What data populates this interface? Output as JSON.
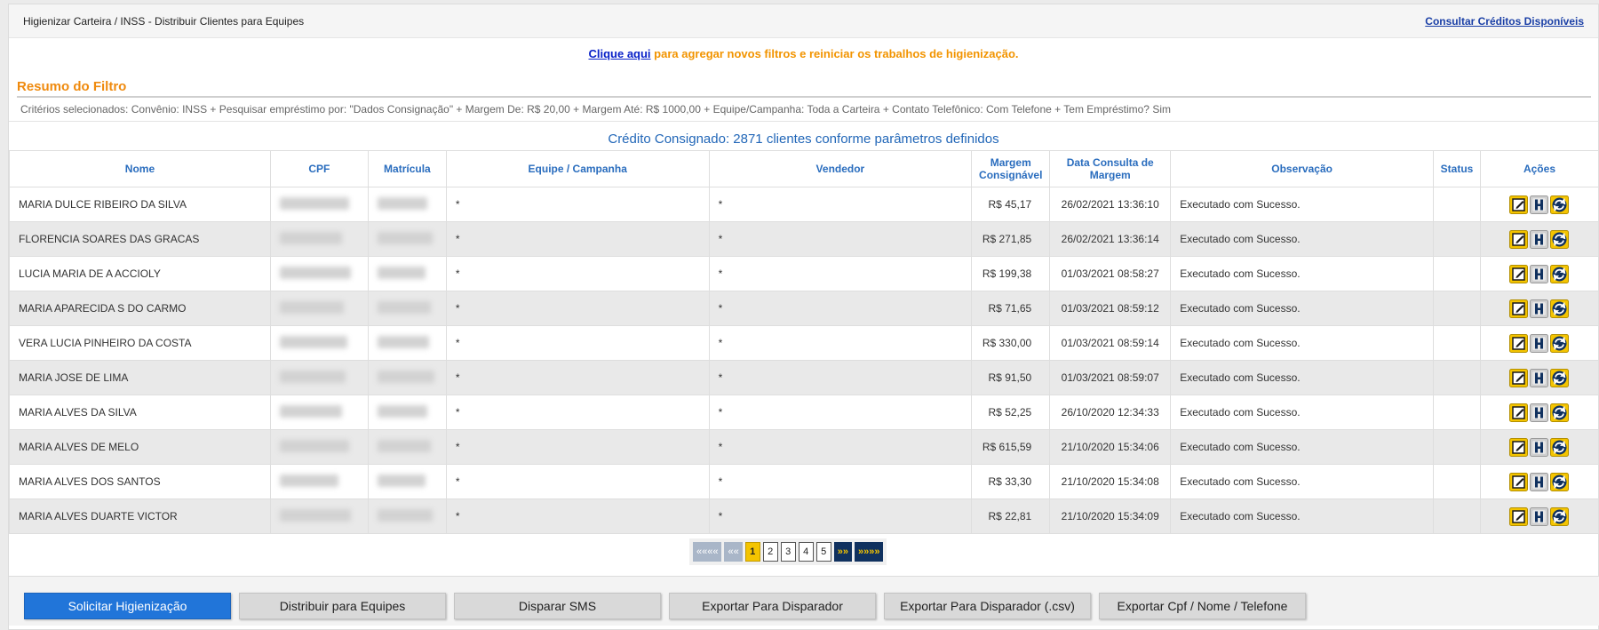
{
  "header": {
    "breadcrumb": "Higienizar Carteira / INSS - Distribuir Clientes para Equipes",
    "credits_link": "Consultar Créditos Disponíveis"
  },
  "reset": {
    "link": "Clique aqui",
    "text": " para agregar novos filtros e reiniciar os trabalhos de higienização."
  },
  "summary": {
    "title": "Resumo do Filtro",
    "criteria": "Critérios selecionados: Convênio: INSS + Pesquisar empréstimo por: \"Dados Consignação\" + Margem De: R$ 20,00 + Margem Até: R$ 1000,00 + Equipe/Campanha: Toda a Carteira + Contato Telefônico: Com Telefone + Tem Empréstimo? Sim"
  },
  "result_count": "Crédito Consignado: 2871 clientes conforme parâmetros definidos",
  "table": {
    "headers": {
      "nome": "Nome",
      "cpf": "CPF",
      "matricula": "Matrícula",
      "equipe": "Equipe / Campanha",
      "vendedor": "Vendedor",
      "margem": "Margem Consignável",
      "data": "Data Consulta de Margem",
      "obs": "Observação",
      "status": "Status",
      "acoes": "Ações"
    },
    "rows": [
      {
        "nome": "MARIA DULCE RIBEIRO DA SILVA",
        "equipe": "*",
        "vendedor": "*",
        "margem": "R$ 45,17",
        "data": "26/02/2021 13:36:10",
        "obs": "Executado com Sucesso.",
        "status": ""
      },
      {
        "nome": "FLORENCIA SOARES DAS GRACAS",
        "equipe": "*",
        "vendedor": "*",
        "margem": "R$ 271,85",
        "data": "26/02/2021 13:36:14",
        "obs": "Executado com Sucesso.",
        "status": ""
      },
      {
        "nome": "LUCIA MARIA DE A ACCIOLY",
        "equipe": "*",
        "vendedor": "*",
        "margem": "R$ 199,38",
        "data": "01/03/2021 08:58:27",
        "obs": "Executado com Sucesso.",
        "status": ""
      },
      {
        "nome": "MARIA APARECIDA S DO CARMO",
        "equipe": "*",
        "vendedor": "*",
        "margem": "R$ 71,65",
        "data": "01/03/2021 08:59:12",
        "obs": "Executado com Sucesso.",
        "status": ""
      },
      {
        "nome": "VERA LUCIA PINHEIRO DA COSTA",
        "equipe": "*",
        "vendedor": "*",
        "margem": "R$ 330,00",
        "data": "01/03/2021 08:59:14",
        "obs": "Executado com Sucesso.",
        "status": ""
      },
      {
        "nome": "MARIA JOSE DE LIMA",
        "equipe": "*",
        "vendedor": "*",
        "margem": "R$ 91,50",
        "data": "01/03/2021 08:59:07",
        "obs": "Executado com Sucesso.",
        "status": ""
      },
      {
        "nome": "MARIA ALVES DA SILVA",
        "equipe": "*",
        "vendedor": "*",
        "margem": "R$ 52,25",
        "data": "26/10/2020 12:34:33",
        "obs": "Executado com Sucesso.",
        "status": ""
      },
      {
        "nome": "MARIA ALVES DE MELO",
        "equipe": "*",
        "vendedor": "*",
        "margem": "R$ 615,59",
        "data": "21/10/2020 15:34:06",
        "obs": "Executado com Sucesso.",
        "status": ""
      },
      {
        "nome": "MARIA ALVES DOS SANTOS",
        "equipe": "*",
        "vendedor": "*",
        "margem": "R$ 33,30",
        "data": "21/10/2020 15:34:08",
        "obs": "Executado com Sucesso.",
        "status": ""
      },
      {
        "nome": "MARIA ALVES DUARTE VICTOR",
        "equipe": "*",
        "vendedor": "*",
        "margem": "R$ 22,81",
        "data": "21/10/2020 15:34:09",
        "obs": "Executado com Sucesso.",
        "status": ""
      }
    ],
    "action_icons": [
      "edit-icon",
      "history-h-icon",
      "refresh-icon"
    ]
  },
  "pager": {
    "first": "«««« ",
    "prev": "««",
    "pages": [
      "1",
      "2",
      "3",
      "4",
      "5"
    ],
    "current": "1",
    "next": "»»",
    "last": "»»»»"
  },
  "footer_buttons": [
    "Solicitar Higienização",
    "Distribuir para Equipes",
    "Disparar SMS",
    "Exportar Para Disparador",
    "Exportar Para Disparador (.csv)",
    "Exportar Cpf / Nome / Telefone"
  ],
  "colors": {
    "accent_blue": "#2175d9",
    "header_blue": "#2a6dbe",
    "orange": "#ef8a0e",
    "pager_navy": "#10315f",
    "pager_yellow": "#f4c400"
  }
}
